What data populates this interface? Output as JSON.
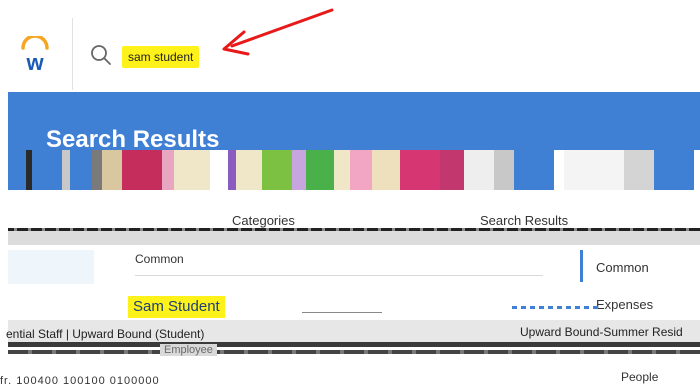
{
  "header": {
    "logo_icon": "workday-logo",
    "search_icon": "search-icon",
    "search_query": "sam student",
    "annotation": "red-arrow"
  },
  "page": {
    "title": "Search Results",
    "banner_color": "#3f7fd4"
  },
  "columns": {
    "categories_label": "Categories",
    "search_results_label": "Search Results"
  },
  "center": {
    "common_label": "Common"
  },
  "categories": {
    "items": [
      "Common",
      "Expenses",
      "People"
    ],
    "active": "Common"
  },
  "result": {
    "name": "Sam Student",
    "role_left": "ential Staff | Upward Bound (Student)",
    "role_right": "Upward Bound-Summer Resid",
    "employee_label": "Employee",
    "bottom_fragment": "fr. 100400 100100 0100000"
  },
  "colors": {
    "highlight": "#fff11a",
    "accent": "#3f7fd4",
    "arrow": "#e81919"
  }
}
